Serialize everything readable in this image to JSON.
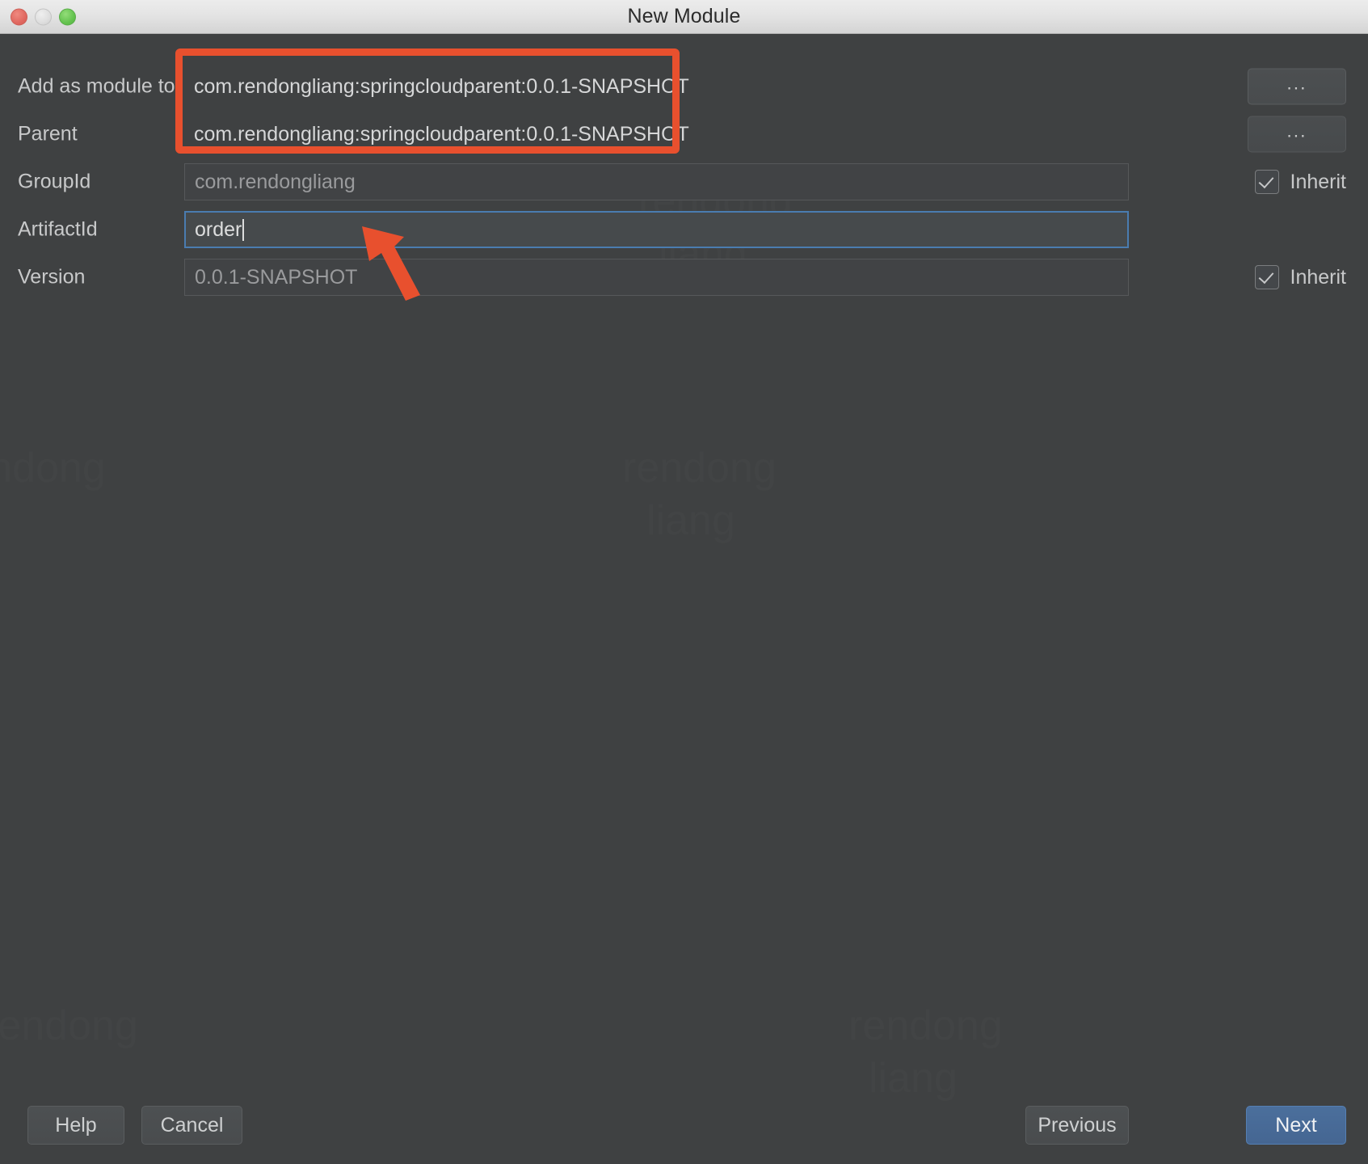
{
  "window": {
    "title": "New Module",
    "traffic_lights": [
      "close",
      "minimize",
      "maximize"
    ]
  },
  "form": {
    "rows": [
      {
        "label": "Add as module to",
        "value": "com.rendongliang:springcloudparent:0.0.1-SNAPSHOT",
        "kind": "plain",
        "browse_label": "...",
        "has_browse": true,
        "has_inherit": false
      },
      {
        "label": "Parent",
        "value": "com.rendongliang:springcloudparent:0.0.1-SNAPSHOT",
        "kind": "plain",
        "browse_label": "...",
        "has_browse": true,
        "has_inherit": false
      },
      {
        "label": "GroupId",
        "value": "com.rendongliang",
        "kind": "readonly",
        "has_browse": false,
        "has_inherit": true,
        "inherit_label": "Inherit",
        "inherit_checked": true
      },
      {
        "label": "ArtifactId",
        "value": "order",
        "kind": "focused",
        "has_browse": false,
        "has_inherit": false,
        "focused": true
      },
      {
        "label": "Version",
        "value": "0.0.1-SNAPSHOT",
        "kind": "readonly",
        "has_browse": false,
        "has_inherit": true,
        "inherit_label": "Inherit",
        "inherit_checked": true
      }
    ]
  },
  "footer": {
    "help_label": "Help",
    "cancel_label": "Cancel",
    "previous_label": "Previous",
    "next_label": "Next"
  },
  "annotations": {
    "highlight_rect_note": "red rectangle around Add-as-module-to and Parent values",
    "arrow_note": "red arrow pointing at ArtifactId input",
    "color": "#e8502e"
  },
  "watermark": {
    "line1": "rendong",
    "line2": "liang"
  },
  "colors": {
    "dialog_bg": "#3f4142",
    "titlebar_bg": "#e4e4e4",
    "text": "#c8c9ca",
    "placeholder": "#9a9b9d",
    "focus_border": "#4a7cb0",
    "primary_button": "#4b6f9c",
    "annotation_red": "#e8502e"
  }
}
